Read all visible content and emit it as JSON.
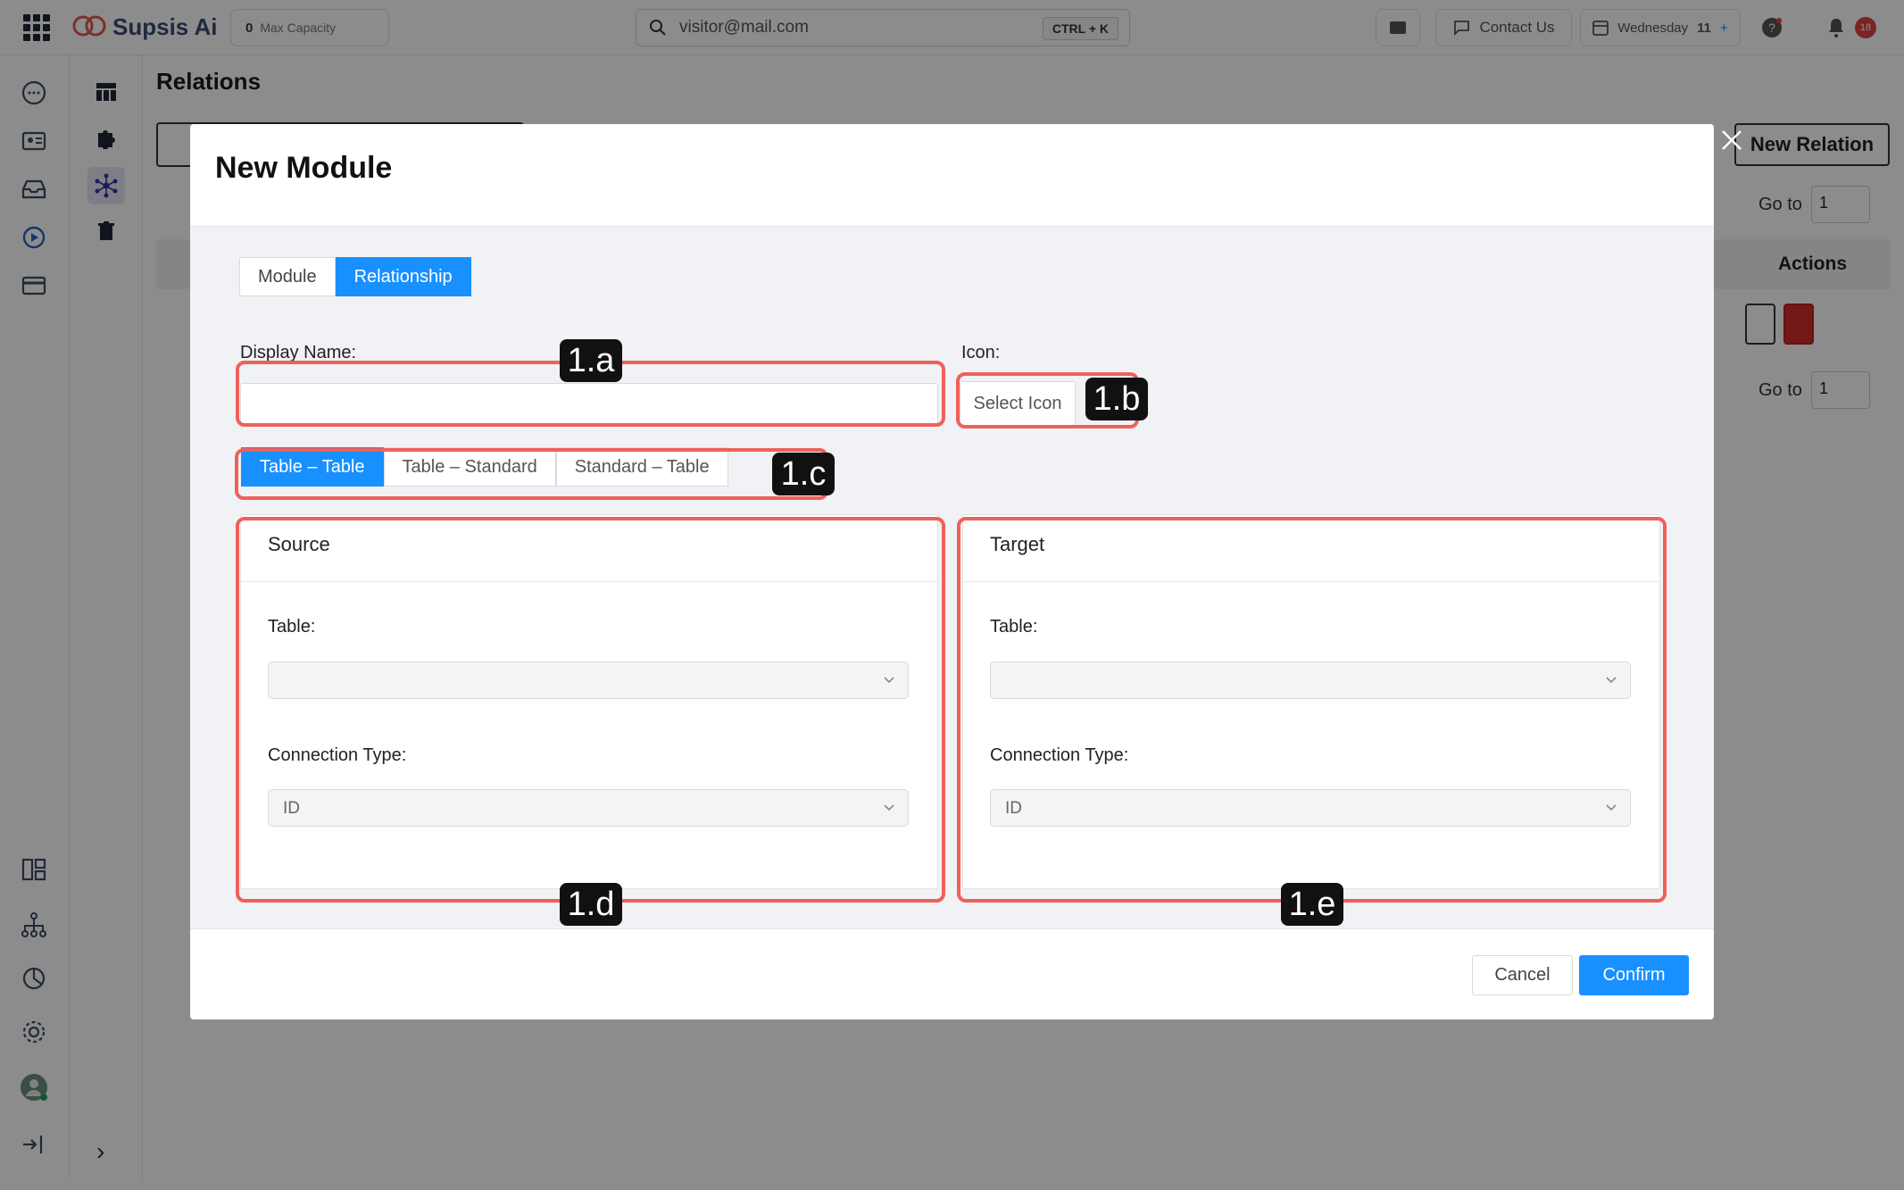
{
  "topbar": {
    "brand": "Supsis Ai",
    "capacity_count": "0",
    "capacity_label": "Max Capacity",
    "search_value": "visitor@mail.com",
    "search_shortcut": "CTRL + K",
    "contact_label": "Contact Us",
    "date_label": "Wednesday",
    "date_day": "11",
    "notification_count": "18"
  },
  "page": {
    "title": "Relations",
    "new_relation_label": "New Relation",
    "goto_label": "Go to",
    "goto_value": "1",
    "actions_header": "Actions"
  },
  "modal": {
    "title": "New Module",
    "tabs": [
      "Module",
      "Relationship"
    ],
    "active_tab": "Relationship",
    "display_name_label": "Display Name:",
    "display_name_value": "",
    "icon_label": "Icon:",
    "select_icon_label": "Select Icon",
    "type_tabs": [
      "Table – Table",
      "Table – Standard",
      "Standard – Table"
    ],
    "source": {
      "title": "Source",
      "table_label": "Table:",
      "table_value": "",
      "connection_label": "Connection Type:",
      "connection_value": "ID"
    },
    "target": {
      "title": "Target",
      "table_label": "Table:",
      "table_value": "",
      "connection_label": "Connection Type:",
      "connection_value": "ID"
    },
    "cancel_label": "Cancel",
    "confirm_label": "Confirm"
  },
  "annotations": {
    "a": "1.a",
    "b": "1.b",
    "c": "1.c",
    "d": "1.d",
    "e": "1.e"
  },
  "colors": {
    "primary": "#1890ff",
    "highlight": "#f0605a",
    "danger": "#d12b2b"
  }
}
